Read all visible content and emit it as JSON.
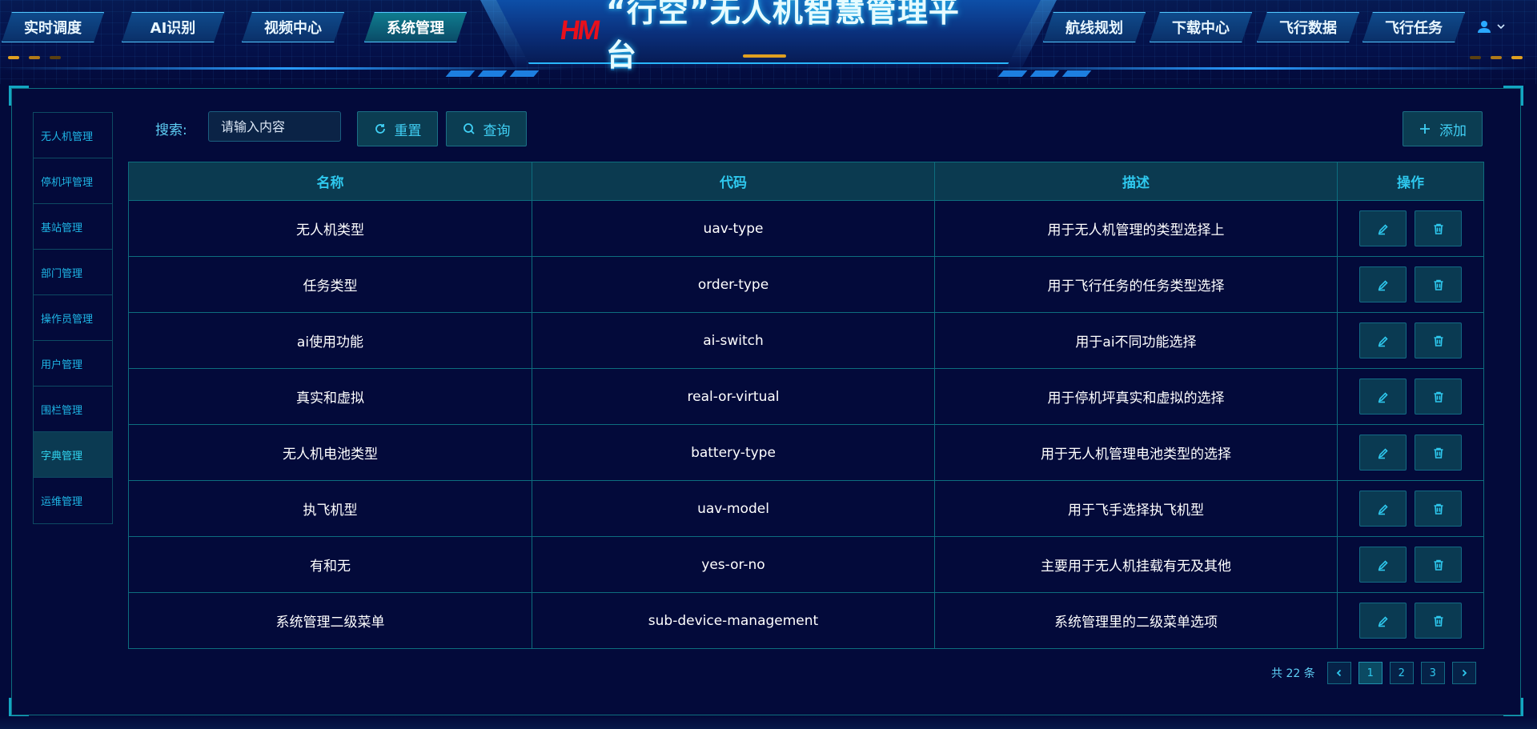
{
  "app": {
    "title": "“行空”无人机智慧管理平台",
    "logo_text": "HM"
  },
  "nav": {
    "left_tabs": [
      {
        "label": "实时调度",
        "active": false
      },
      {
        "label": "AI识别",
        "active": false
      },
      {
        "label": "视频中心",
        "active": false
      },
      {
        "label": "系统管理",
        "active": true
      }
    ],
    "right_tabs": [
      {
        "label": "航线规划"
      },
      {
        "label": "下载中心"
      },
      {
        "label": "飞行数据"
      },
      {
        "label": "飞行任务"
      }
    ],
    "user_icon": "user-icon"
  },
  "sidebar": {
    "items": [
      {
        "label": "无人机管理",
        "active": false
      },
      {
        "label": "停机坪管理",
        "active": false
      },
      {
        "label": "基站管理",
        "active": false
      },
      {
        "label": "部门管理",
        "active": false
      },
      {
        "label": "操作员管理",
        "active": false
      },
      {
        "label": "用户管理",
        "active": false
      },
      {
        "label": "围栏管理",
        "active": false
      },
      {
        "label": "字典管理",
        "active": true
      },
      {
        "label": "运维管理",
        "active": false
      }
    ]
  },
  "toolbar": {
    "search_label": "搜索:",
    "search_placeholder": "请输入内容",
    "reset_label": "重置",
    "query_label": "查询",
    "add_label": "添加"
  },
  "table": {
    "headers": [
      "名称",
      "代码",
      "描述",
      "操作"
    ],
    "rows": [
      {
        "name": "无人机类型",
        "code": "uav-type",
        "desc": "用于无人机管理的类型选择上"
      },
      {
        "name": "任务类型",
        "code": "order-type",
        "desc": "用于飞行任务的任务类型选择"
      },
      {
        "name": "ai使用功能",
        "code": "ai-switch",
        "desc": "用于ai不同功能选择"
      },
      {
        "name": "真实和虚拟",
        "code": "real-or-virtual",
        "desc": "用于停机坪真实和虚拟的选择"
      },
      {
        "name": "无人机电池类型",
        "code": "battery-type",
        "desc": "用于无人机管理电池类型的选择"
      },
      {
        "name": "执飞机型",
        "code": "uav-model",
        "desc": "用于飞手选择执飞机型"
      },
      {
        "name": "有和无",
        "code": "yes-or-no",
        "desc": "主要用于无人机挂载有无及其他"
      },
      {
        "name": "系统管理二级菜单",
        "code": "sub-device-management",
        "desc": "系统管理里的二级菜单选项"
      }
    ]
  },
  "pagination": {
    "total_text": "共 22 条",
    "pages": [
      "1",
      "2",
      "3"
    ],
    "current": "1"
  },
  "colors": {
    "background": "#030a3a",
    "accent": "#2ec8ee",
    "border": "#0d6d7e",
    "logo_red": "#e8101c"
  }
}
